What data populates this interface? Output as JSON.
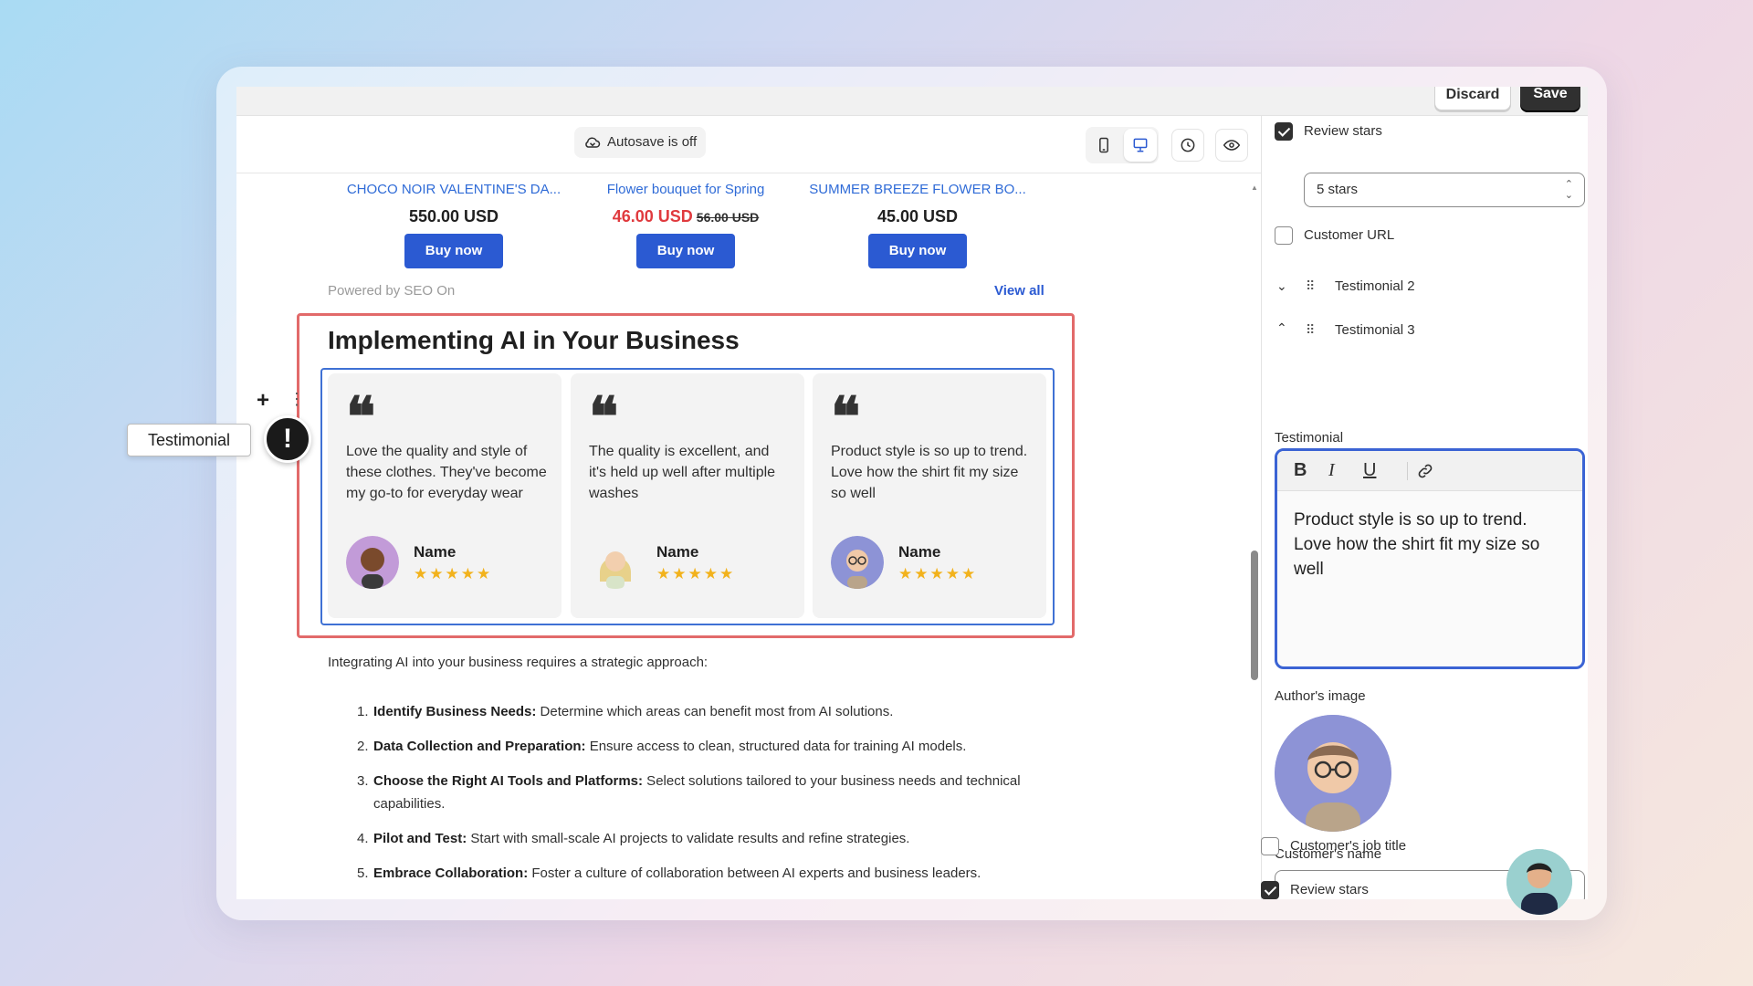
{
  "topbar": {
    "discard_label": "Discard",
    "save_label": "Save"
  },
  "toolbar": {
    "autosave_label": "Autosave is off"
  },
  "products": [
    {
      "name": "CHOCO NOIR VALENTINE'S DA...",
      "price": "550.00 USD",
      "old_price": "",
      "buy_label": "Buy now"
    },
    {
      "name": "Flower bouquet for Spring",
      "price": "46.00 USD",
      "old_price": "56.00 USD",
      "buy_label": "Buy now"
    },
    {
      "name": "SUMMER BREEZE FLOWER BO...",
      "price": "45.00 USD",
      "old_price": "",
      "buy_label": "Buy now"
    }
  ],
  "powered_by": "Powered by SEO On",
  "view_all": "View all",
  "section": {
    "title": "Implementing AI in Your Business"
  },
  "testimonials": [
    {
      "quote_mark": "❝",
      "text": "Love the quality and style of these clothes. They've become my go-to for everyday wear",
      "name": "Name",
      "stars": "★★★★★"
    },
    {
      "quote_mark": "❝",
      "text": "The quality is excellent, and it's held up well after multiple washes",
      "name": "Name",
      "stars": "★★★★★"
    },
    {
      "quote_mark": "❝",
      "text": "Product style is so up to trend. Love how the shirt fit my size so well",
      "name": "Name",
      "stars": "★★★★★"
    }
  ],
  "block_tooltip": "Testimonial",
  "article": {
    "intro": "Integrating AI into your business requires a strategic approach:",
    "steps": [
      {
        "num": "1.",
        "bold": "Identify Business Needs:",
        "text": " Determine which areas can benefit most from AI solutions."
      },
      {
        "num": "2.",
        "bold": "Data Collection and Preparation:",
        "text": " Ensure access to clean, structured data for training AI models."
      },
      {
        "num": "3.",
        "bold": "Choose the Right AI Tools and Platforms:",
        "text": " Select solutions tailored to your business needs and technical capabilities."
      },
      {
        "num": "4.",
        "bold": "Pilot and Test:",
        "text": " Start with small-scale AI projects to validate results and refine strategies."
      },
      {
        "num": "5.",
        "bold": "Embrace Collaboration:",
        "text": " Foster a culture of collaboration between AI experts and business leaders."
      }
    ]
  },
  "panel": {
    "review_stars_label": "Review stars",
    "review_stars_checked": true,
    "stars_select_value": "5 stars",
    "customer_url_label": "Customer URL",
    "customer_url_checked": false,
    "tree": [
      {
        "label": "Testimonial 2",
        "expanded": false
      },
      {
        "label": "Testimonial 3",
        "expanded": true
      }
    ],
    "testimonial_label": "Testimonial",
    "rte_text": "Product style is so up to trend. Love how the shirt fit my size so well",
    "authors_image_label": "Author's image",
    "customer_name_label": "Customer's name",
    "customer_name_value": "",
    "job_title_label": "Customer's job title",
    "job_title_checked": false,
    "review_stars_label_2": "Review stars",
    "review_stars_checked_2": true
  },
  "colors": {
    "accent_blue": "#2b5ad2",
    "sale_red": "#e03a3e",
    "star_yellow": "#f2b21c",
    "section_outline": "#e26a6a",
    "active_field": "#3b63d4"
  },
  "icons": [
    "cloud-off-icon",
    "mobile-icon",
    "desktop-icon",
    "history-icon",
    "eye-icon",
    "plus-icon",
    "drag-handle-icon",
    "warning-icon",
    "bold-icon",
    "italic-icon",
    "underline-icon",
    "link-icon",
    "chevron-down-icon",
    "chevron-up-icon",
    "select-arrows-icon"
  ]
}
